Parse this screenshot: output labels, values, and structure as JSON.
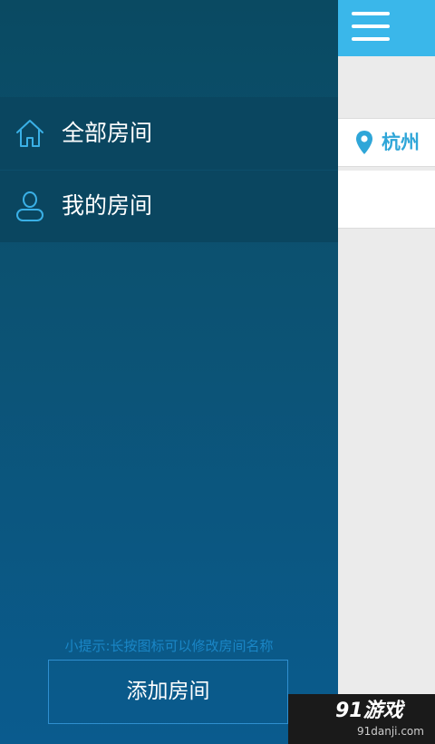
{
  "header": {
    "menu_icon": "hamburger-icon"
  },
  "location": {
    "icon": "location-pin-icon",
    "city": "杭州",
    "color": "#2fa6d8"
  },
  "drawer": {
    "items": [
      {
        "icon": "home-icon",
        "label": "全部房间"
      },
      {
        "icon": "user-icon",
        "label": "我的房间"
      }
    ],
    "tip": "小提示:长按图标可以修改房间名称",
    "add_button_label": "添加房间"
  },
  "watermark": {
    "main": "91游戏",
    "sub": "91danji.com"
  },
  "colors": {
    "accent": "#3ab7ea",
    "drawer_bg": "#0a5272"
  }
}
